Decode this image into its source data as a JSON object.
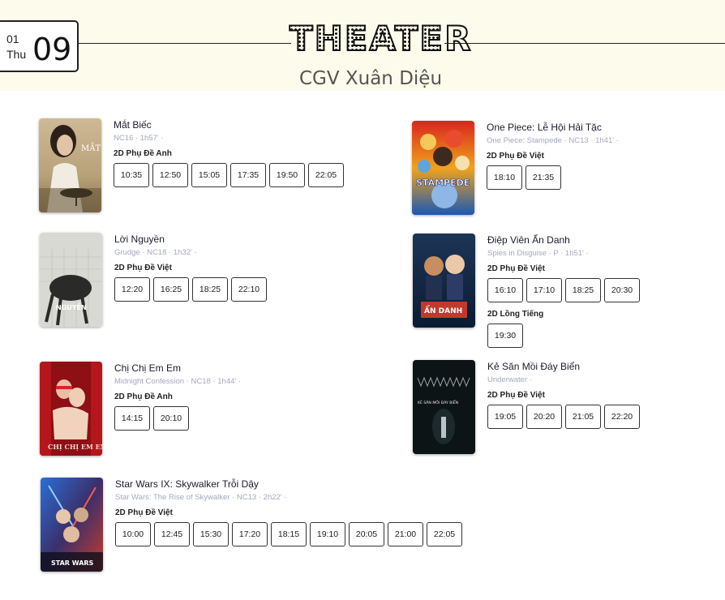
{
  "header": {
    "month": "01",
    "weekday": "Thu",
    "day": "09",
    "title": "THEATER",
    "cinema": "CGV Xuân Diệu"
  },
  "movies": [
    {
      "title": "Mắt Biếc",
      "meta": "NC16 · 1h57' ·",
      "formats": [
        {
          "label": "2D Phụ Đề Anh",
          "times": [
            "10:35",
            "12:50",
            "15:05",
            "17:35",
            "19:50",
            "22:05"
          ]
        }
      ]
    },
    {
      "title": "One Piece: Lễ Hội Hải Tặc",
      "meta": "One Piece: Stampede · NC13 · 1h41' ·",
      "formats": [
        {
          "label": "2D Phụ Đề Việt",
          "times": [
            "18:10",
            "21:35"
          ]
        }
      ]
    },
    {
      "title": "Lời Nguyền",
      "meta": "Grudge · NC18 · 1h32' ·",
      "formats": [
        {
          "label": "2D Phụ Đề Việt",
          "times": [
            "12:20",
            "16:25",
            "18:25",
            "22:10"
          ]
        }
      ]
    },
    {
      "title": "Điệp Viên Ẩn Danh",
      "meta": "Spies in Disguise · P · 1h51' ·",
      "formats": [
        {
          "label": "2D Phụ Đề Việt",
          "times": [
            "16:10",
            "17:10",
            "18:25",
            "20:30"
          ]
        },
        {
          "label": "2D Lồng Tiếng",
          "times": [
            "19:30"
          ]
        }
      ]
    },
    {
      "title": "Chị Chị Em Em",
      "meta": "Midnight Confession · NC18 · 1h44' ·",
      "formats": [
        {
          "label": "2D Phụ Đề Anh",
          "times": [
            "14:15",
            "20:10"
          ]
        }
      ]
    },
    {
      "title": "Kẻ Săn Mồi Đáy Biển",
      "meta": "Underwater ·",
      "formats": [
        {
          "label": "2D Phụ Đề Việt",
          "times": [
            "19:05",
            "20:20",
            "21:05",
            "22:20"
          ]
        }
      ]
    },
    {
      "title": "Star Wars IX: Skywalker Trỗi Dậy",
      "meta": "Star Wars: The Rise of Skywalker · NC13 · 2h22' ·",
      "formats": [
        {
          "label": "2D Phụ Đề Việt",
          "times": [
            "10:00",
            "12:45",
            "15:30",
            "17:20",
            "18:15",
            "19:10",
            "20:05",
            "21:00",
            "22:05"
          ]
        }
      ]
    }
  ],
  "poster_text": {
    "mat_biec": "MẮT BIẾC",
    "one_piece": "STAMPEDE",
    "loi_nguyen": "NGUYỀN",
    "diep_vien": "ẨN DANH",
    "chi_chi": "CHỊ CHỊ EM EM",
    "ke_san": "KẺ SĂN MỒI ĐÁY BIỂN",
    "star_wars": "STAR WARS"
  }
}
